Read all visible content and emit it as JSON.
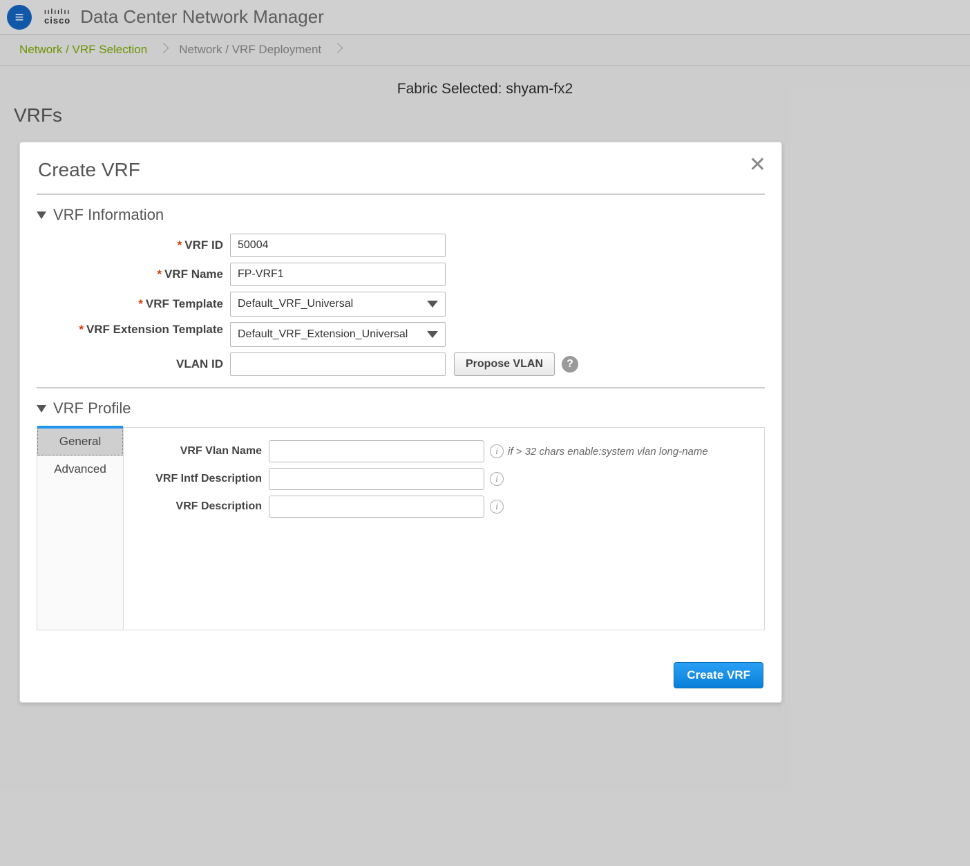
{
  "header": {
    "app_title": "Data Center Network Manager",
    "logo_text": "cisco",
    "logo_bars": "ıılıılıı"
  },
  "breadcrumb": {
    "step1": "Network / VRF Selection",
    "step2": "Network / VRF Deployment"
  },
  "context": {
    "fabric_label": "Fabric Selected: shyam-fx2",
    "page_heading": "VRFs"
  },
  "modal": {
    "title": "Create VRF",
    "section_info": "VRF Information",
    "section_profile": "VRF Profile",
    "submit_label": "Create VRF",
    "info": {
      "vrf_id_label": "VRF ID",
      "vrf_id_value": "50004",
      "vrf_name_label": "VRF Name",
      "vrf_name_value": "FP-VRF1",
      "vrf_template_label": "VRF Template",
      "vrf_template_value": "Default_VRF_Universal",
      "vrf_ext_label": "VRF Extension Template",
      "vrf_ext_value": "Default_VRF_Extension_Universal",
      "vlan_id_label": "VLAN ID",
      "vlan_id_value": "",
      "propose_label": "Propose VLAN"
    },
    "profile": {
      "tabs": {
        "general": "General",
        "advanced": "Advanced"
      },
      "vlan_name_label": "VRF Vlan Name",
      "vlan_name_hint": "if > 32 chars enable:system vlan long-name",
      "intf_desc_label": "VRF Intf Description",
      "desc_label": "VRF Description"
    }
  }
}
